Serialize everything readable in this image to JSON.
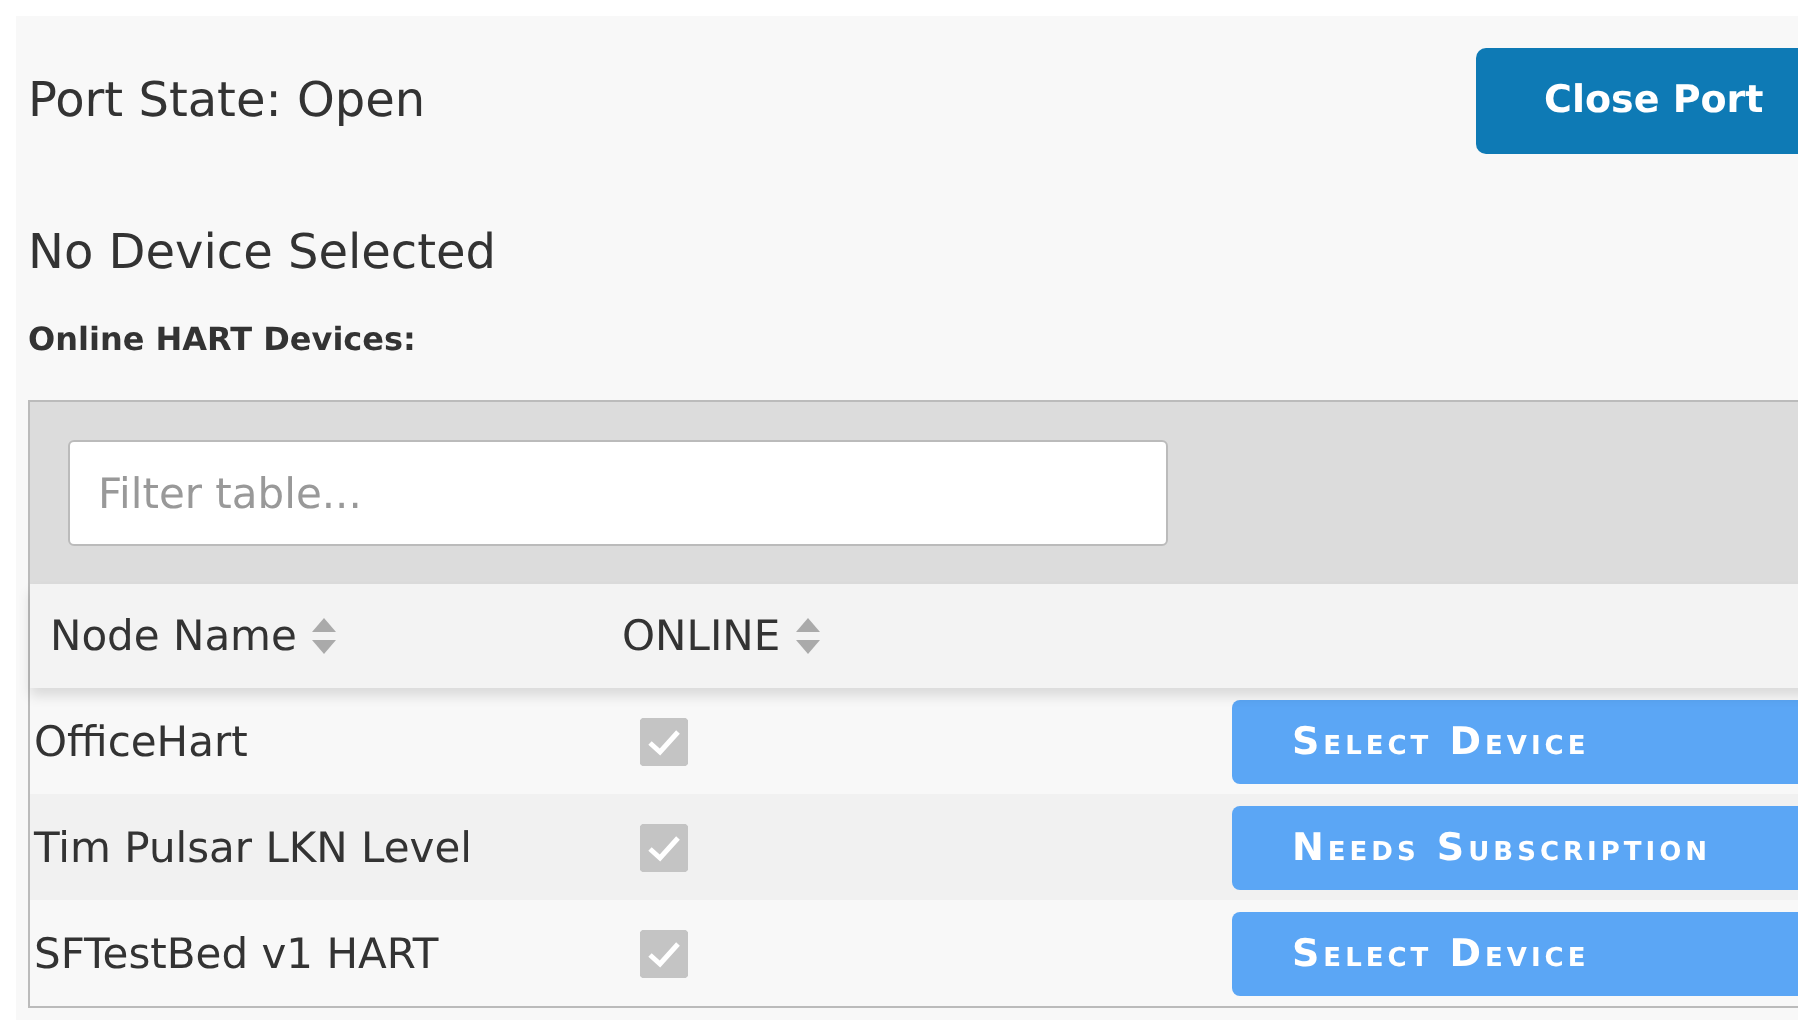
{
  "port_state": "Port State: Open",
  "close_button": "Close Port",
  "device_status": "No Device Selected",
  "section_title": "Online HART Devices:",
  "filter": {
    "placeholder": "Filter table..."
  },
  "columns": [
    "Node Name",
    "ONLINE"
  ],
  "rows": [
    {
      "name": "OfficeHart",
      "online": true,
      "action": "Select Device"
    },
    {
      "name": "Tim Pulsar LKN Level",
      "online": true,
      "action": "Needs Subscription"
    },
    {
      "name": "SFTestBed v1 HART",
      "online": true,
      "action": "Select Device"
    }
  ]
}
